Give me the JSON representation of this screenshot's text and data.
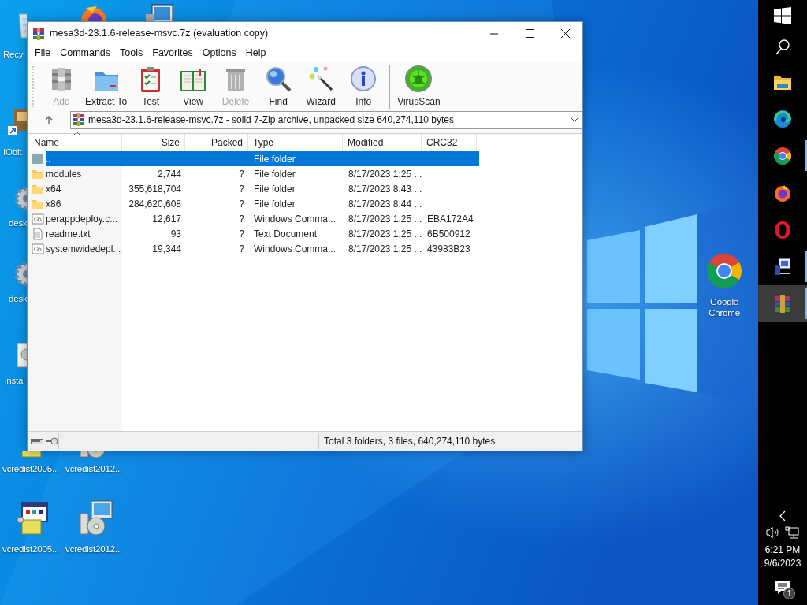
{
  "desktop_icons": [
    {
      "kind": "recycle",
      "label": "Recy"
    },
    {
      "kind": "browser"
    },
    {
      "kind": "monitor"
    },
    {
      "kind": "app",
      "label": "IObit"
    },
    {
      "kind": "gear",
      "label": "desk"
    },
    {
      "kind": "gear",
      "label": "desk"
    },
    {
      "kind": "installer",
      "label": "instal"
    },
    {
      "kind": "box",
      "label": "vcredist2005..."
    },
    {
      "kind": "disc",
      "label": "vcredist2012..."
    },
    {
      "kind": "box",
      "label": "vcredist2005..."
    },
    {
      "kind": "disc",
      "label": "vcredist2012..."
    },
    {
      "kind": "chrome",
      "label": "Google Chrome"
    }
  ],
  "window": {
    "title": "mesa3d-23.1.6-release-msvc.7z (evaluation copy)",
    "menu": [
      "File",
      "Commands",
      "Tools",
      "Favorites",
      "Options",
      "Help"
    ],
    "toolbar": [
      {
        "kind": "add",
        "label": "Add",
        "disabled": true
      },
      {
        "kind": "extract",
        "label": "Extract To",
        "disabled": false
      },
      {
        "kind": "test",
        "label": "Test",
        "disabled": false
      },
      {
        "kind": "view",
        "label": "View",
        "disabled": false
      },
      {
        "kind": "delete",
        "label": "Delete",
        "disabled": true
      },
      {
        "kind": "find",
        "label": "Find",
        "disabled": false
      },
      {
        "kind": "wizard",
        "label": "Wizard",
        "disabled": false
      },
      {
        "kind": "info",
        "label": "Info",
        "disabled": false
      },
      {
        "kind": "separator"
      },
      {
        "kind": "virusscan",
        "label": "VirusScan",
        "disabled": false
      }
    ],
    "address": "mesa3d-23.1.6-release-msvc.7z - solid 7-Zip archive, unpacked size 640,274,110 bytes",
    "columns": [
      "Name",
      "Size",
      "Packed",
      "Type",
      "Modified",
      "CRC32"
    ],
    "rows": [
      {
        "kind": "parent",
        "name": "..",
        "type": "File folder",
        "selected": true
      },
      {
        "kind": "folder",
        "name": "modules",
        "size": "2,744",
        "packed": "?",
        "type": "File folder",
        "modified": "8/17/2023 1:25 ...",
        "selected": false
      },
      {
        "kind": "folder",
        "name": "x64",
        "size": "355,618,704",
        "packed": "?",
        "type": "File folder",
        "modified": "8/17/2023 8:43 ...",
        "selected": false
      },
      {
        "kind": "folder",
        "name": "x86",
        "size": "284,620,608",
        "packed": "?",
        "type": "File folder",
        "modified": "8/17/2023 8:44 ...",
        "selected": false
      },
      {
        "kind": "script",
        "name": "perappdeploy.c...",
        "size": "12,617",
        "packed": "?",
        "type": "Windows Comma...",
        "modified": "8/17/2023 1:25 ...",
        "crc32": "EBA172A4",
        "selected": false
      },
      {
        "kind": "text",
        "name": "readme.txt",
        "size": "93",
        "packed": "?",
        "type": "Text Document",
        "modified": "8/17/2023 1:25 ...",
        "crc32": "6B500912",
        "selected": false
      },
      {
        "kind": "script",
        "name": "systemwidedepl...",
        "size": "19,344",
        "packed": "?",
        "type": "Windows Comma...",
        "modified": "8/17/2023 1:25 ...",
        "crc32": "43983B23",
        "selected": false
      }
    ],
    "status": "Total 3 folders, 3 files, 640,274,110 bytes"
  },
  "taskbar": {
    "items": [
      {
        "kind": "start",
        "running": false,
        "active": false
      },
      {
        "kind": "search",
        "running": false,
        "active": false
      },
      {
        "kind": "explorer",
        "running": false,
        "active": false
      },
      {
        "kind": "edge",
        "running": false,
        "active": false
      },
      {
        "kind": "chrome",
        "running": true,
        "active": false
      },
      {
        "kind": "firefox",
        "running": false,
        "active": false
      },
      {
        "kind": "opera",
        "running": false,
        "active": false
      },
      {
        "kind": "network-app",
        "running": true,
        "active": false
      },
      {
        "kind": "archiver",
        "running": true,
        "active": true
      }
    ],
    "time": "6:21 PM",
    "date": "9/6/2023",
    "notifications": "1"
  }
}
